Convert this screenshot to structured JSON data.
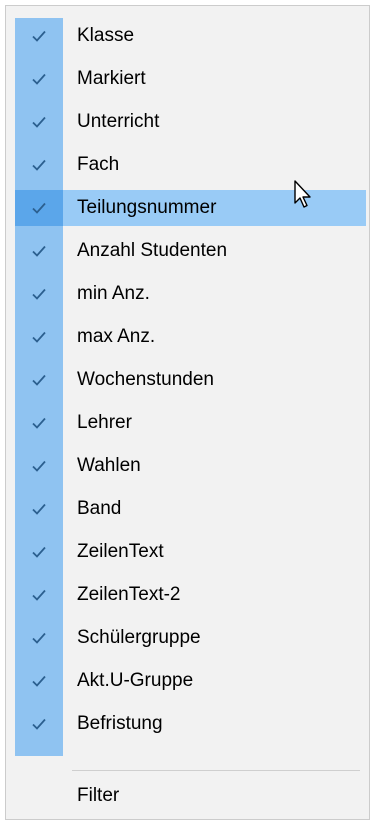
{
  "menu": {
    "items": [
      {
        "label": "Klasse",
        "checked": true
      },
      {
        "label": "Markiert",
        "checked": true
      },
      {
        "label": "Unterricht",
        "checked": true
      },
      {
        "label": "Fach",
        "checked": true
      },
      {
        "label": "Teilungsnummer",
        "checked": true,
        "hovered": true
      },
      {
        "label": "Anzahl Studenten",
        "checked": true
      },
      {
        "label": "min Anz.",
        "checked": true
      },
      {
        "label": "max Anz.",
        "checked": true
      },
      {
        "label": "Wochenstunden",
        "checked": true
      },
      {
        "label": "Lehrer",
        "checked": true
      },
      {
        "label": "Wahlen",
        "checked": true
      },
      {
        "label": "Band",
        "checked": true
      },
      {
        "label": "ZeilenText",
        "checked": true
      },
      {
        "label": "ZeilenText-2",
        "checked": true
      },
      {
        "label": "Schülergruppe",
        "checked": true
      },
      {
        "label": "Akt.U-Gruppe",
        "checked": true
      },
      {
        "label": "Befristung",
        "checked": true
      }
    ],
    "filter_label": "Filter"
  },
  "colors": {
    "menu_background": "#f2f2f2",
    "check_strip": "#8fc3f1",
    "hover_row": "#99cbf6",
    "hover_check": "#5ba6ea",
    "check_mark": "#2b5f8f"
  }
}
